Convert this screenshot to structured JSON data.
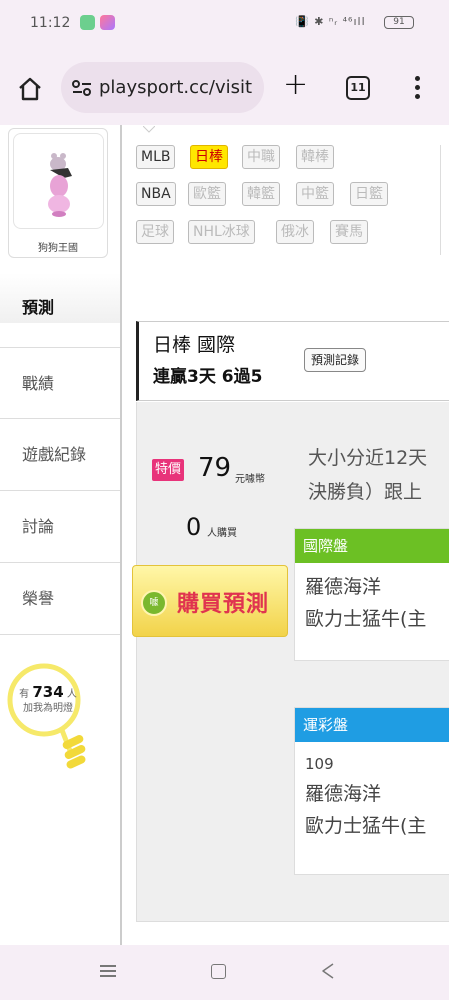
{
  "status_bar": {
    "time": "11:12",
    "right_icons": "📳 ✱ ⁿᵣ ⁴⁶ıll",
    "battery": "91"
  },
  "browser": {
    "url": "playsport.cc/visit",
    "tab_count": "11"
  },
  "sidebar": {
    "user_name": "狗狗王國",
    "items": [
      {
        "label": "預測",
        "active": true
      },
      {
        "label": "戰績"
      },
      {
        "label": "遊戲紀錄"
      },
      {
        "label": "討論"
      },
      {
        "label": "榮譽"
      }
    ],
    "fans_prefix": "有",
    "fans_count": "734",
    "fans_suffix": "人",
    "fans_text": "加我為明燈"
  },
  "sports": {
    "row1": [
      "MLB",
      "日棒",
      "中職",
      "韓棒"
    ],
    "row2": [
      "NBA",
      "歐籃",
      "韓籃",
      "中籃",
      "日籃"
    ],
    "row3": [
      "足球",
      "NHL冰球",
      "俄冰",
      "賽馬"
    ]
  },
  "record": {
    "title": "日棒 國際",
    "streak": "連贏3天 6過5",
    "button": "預測記錄"
  },
  "purchase": {
    "badge": "特價",
    "price": "79",
    "price_unit": "元噱幣",
    "buyers": "0",
    "buyers_unit": "人購買",
    "icon_text": "噱",
    "buy_label": "購買預測"
  },
  "description": {
    "line1": "大小分近12天",
    "line2": "決勝負）跟上"
  },
  "cards": [
    {
      "header": "國際盤",
      "header_color": "#6cc024",
      "line1": "羅德海洋",
      "line2": "歐力士猛牛(主"
    },
    {
      "header": "運彩盤",
      "header_color": "#1f9de3",
      "number": "109",
      "line1": "羅德海洋",
      "line2": "歐力士猛牛(主"
    }
  ]
}
